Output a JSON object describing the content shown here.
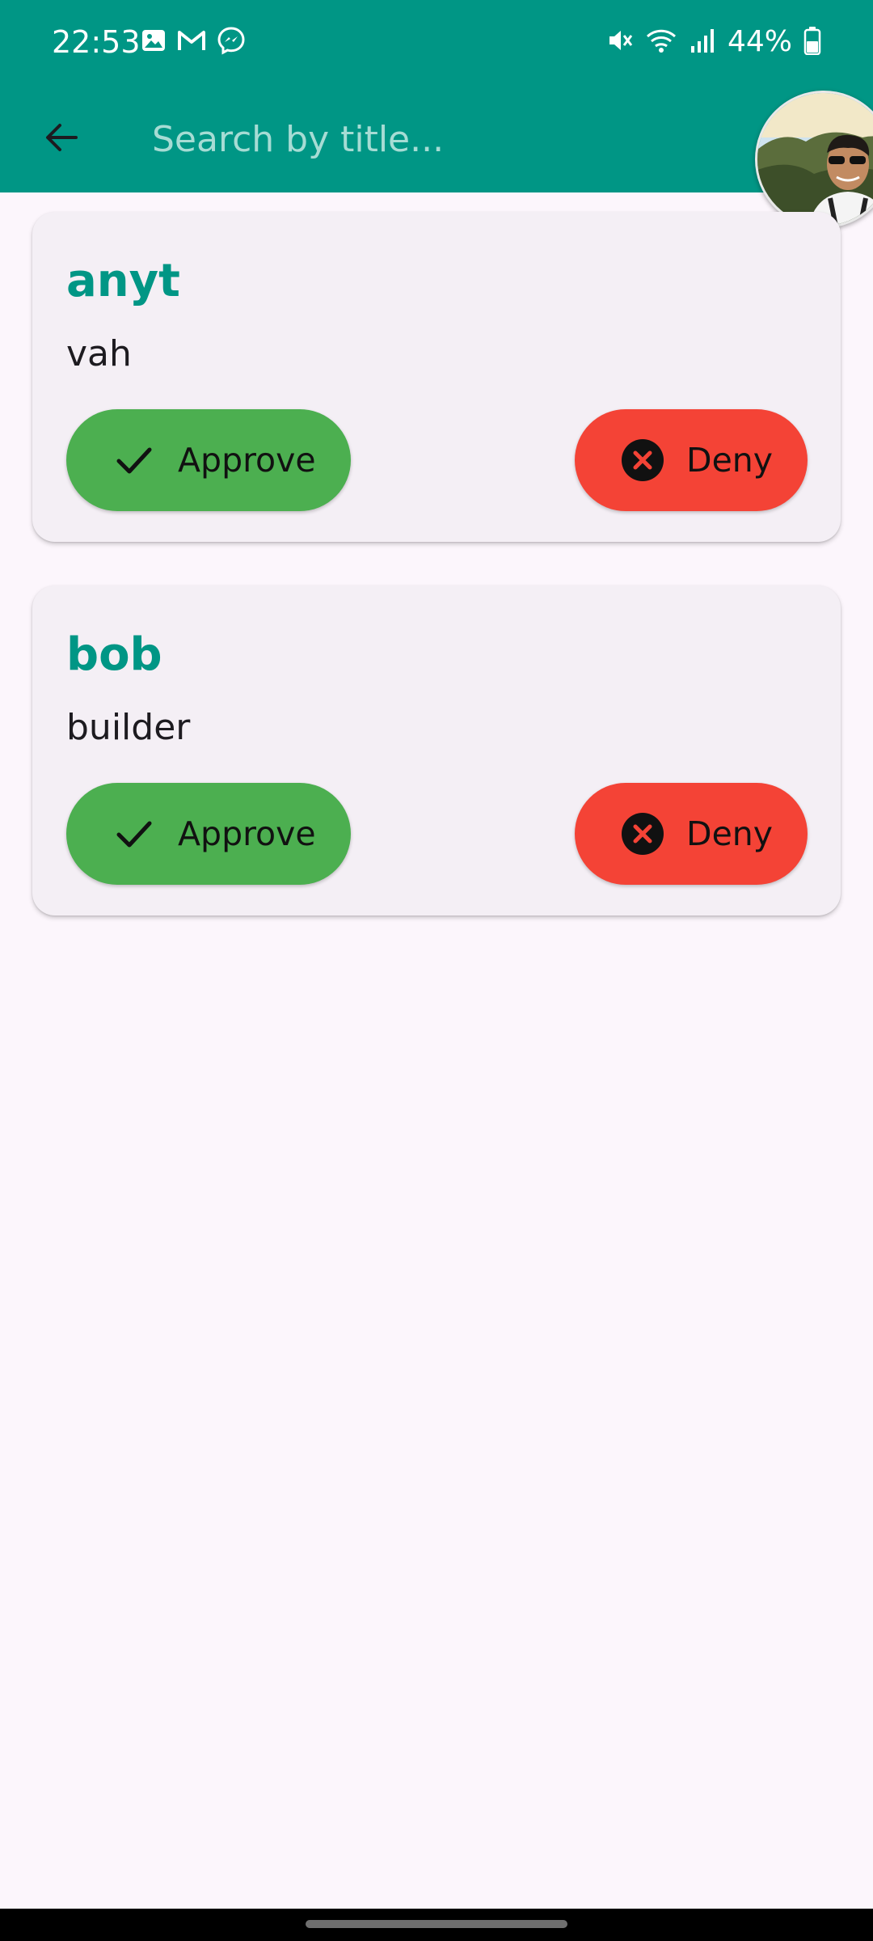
{
  "status_bar": {
    "time": "22:53",
    "notification_icons": [
      "gallery-icon",
      "gmail-icon",
      "messenger-icon"
    ],
    "system_icons": [
      "mute-icon",
      "wifi-icon",
      "signal-icon",
      "battery-icon"
    ],
    "battery": "44%"
  },
  "app_bar": {
    "search_placeholder": "Search by title...",
    "search_value": ""
  },
  "requests": [
    {
      "title": "anyt",
      "subtitle": "vah",
      "approve_label": "Approve",
      "deny_label": "Deny"
    },
    {
      "title": "bob",
      "subtitle": "builder",
      "approve_label": "Approve",
      "deny_label": "Deny"
    }
  ],
  "colors": {
    "primary": "#009685",
    "approve": "#4caf50",
    "deny": "#f44336",
    "background": "#fcf6fc",
    "card": "#f4eff5"
  }
}
